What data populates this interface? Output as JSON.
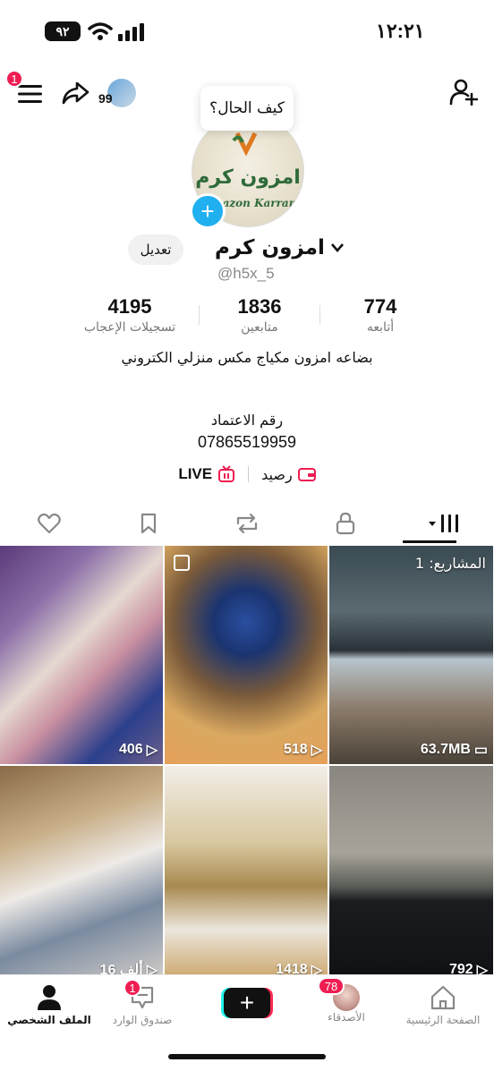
{
  "status": {
    "time": "١٢:٢١",
    "battery": "٩٢"
  },
  "header": {
    "menu_badge": "1",
    "friend_count": "99",
    "tooltip": "كيف الحال؟"
  },
  "profile": {
    "avatar_text": "امزون كرم",
    "avatar_text_en": "Amazon Karram",
    "name": "امزون كرم",
    "handle": "@h5x_5",
    "edit_label": "تعديل"
  },
  "stats": [
    {
      "value": "774",
      "label": "أتابعه"
    },
    {
      "value": "1836",
      "label": "متابعين"
    },
    {
      "value": "4195",
      "label": "تسجيلات الإعجاب"
    }
  ],
  "bio": "بضاعه امزون مكياج مكس منزلي الكتروني",
  "approval": {
    "label": "رقم الاعتماد",
    "number": "07865519959"
  },
  "links": {
    "balance": "رصيد",
    "live": "LIVE"
  },
  "tabs": [
    "videos",
    "private",
    "reposts",
    "favorites",
    "liked"
  ],
  "grid": [
    {
      "count": "518",
      "kind": "views"
    },
    {
      "count": "406",
      "kind": "views"
    },
    {
      "count": "63.7MB",
      "kind": "drafts",
      "drafts_label": "المشاريع: 1"
    },
    {
      "count": "1418",
      "kind": "views"
    },
    {
      "count": "16 ألف",
      "kind": "views"
    },
    {
      "count": "792",
      "kind": "views"
    }
  ],
  "nav": {
    "home": "الصفحة الرئيسية",
    "friends": "الأصدقاء",
    "friends_badge": "78",
    "inbox": "صندوق الوارد",
    "inbox_badge": "1",
    "profile": "الملف الشخصي"
  },
  "colors": {
    "accent": "#ee1d52",
    "plus_blue": "#20b0f0",
    "create_cyan": "#25f4ee"
  }
}
